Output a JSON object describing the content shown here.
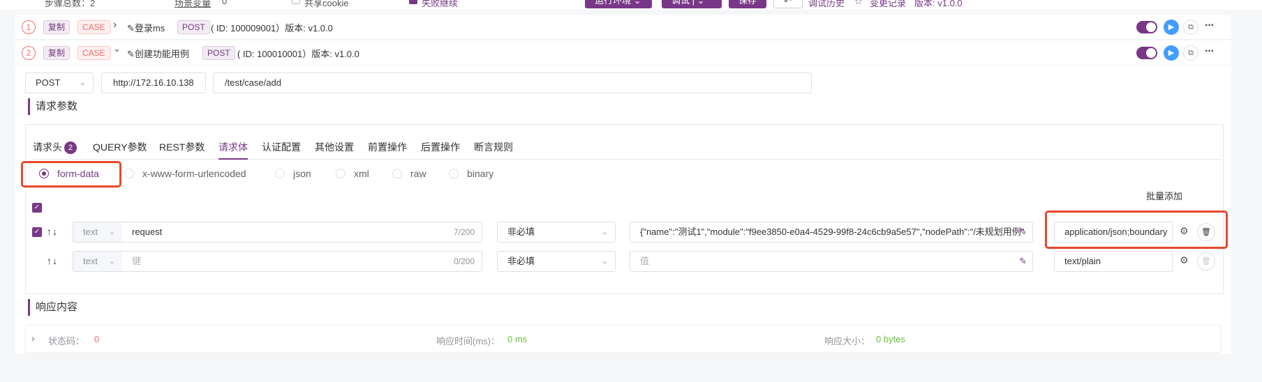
{
  "topbar": {
    "scenario_vars_count_label": "步骤总数：2",
    "scenario_vars_label": "场景变量",
    "scenario_vars_count": "0",
    "share_cookie_label": "共享cookie",
    "fail_stop_label": "失败继续",
    "run_env_button": "运行环境",
    "debug_button": "调试",
    "save_button": "保存",
    "debug_history_link": "调试历史",
    "change_record_link": "变更记录",
    "version_label": "版本: v1.0.0"
  },
  "steps": [
    {
      "index": "1",
      "copy_tag": "复制",
      "case_tag": "CASE",
      "chevron": "›",
      "name": "登录ms",
      "method": "POST",
      "meta": "( ID: 100009001）版本: v1.0.0"
    },
    {
      "index": "2",
      "copy_tag": "复制",
      "case_tag": "CASE",
      "chevron": "⌄",
      "name": "创建功能用例",
      "method": "POST",
      "meta": "( ID: 100010001）版本: v1.0.0"
    }
  ],
  "request": {
    "method": "POST",
    "host": "http://172.16.10.138",
    "path": "/test/case/add"
  },
  "params_section_title": "请求参数",
  "tabs": [
    {
      "label": "请求头",
      "badge": "2"
    },
    {
      "label": "QUERY参数"
    },
    {
      "label": "REST参数"
    },
    {
      "label": "请求体",
      "active": true
    },
    {
      "label": "认证配置"
    },
    {
      "label": "其他设置"
    },
    {
      "label": "前置操作"
    },
    {
      "label": "后置操作"
    },
    {
      "label": "断言规则"
    }
  ],
  "body_types": [
    "form-data",
    "x-www-form-urlencoded",
    "json",
    "xml",
    "raw",
    "binary"
  ],
  "body_type_selected": "form-data",
  "batch_add_label": "批量添加",
  "form_rows": [
    {
      "checked": true,
      "arrows": "↑↓",
      "type": "text",
      "key": "request",
      "key_count": "7/200",
      "required": "非必填",
      "value": "{\"name\":\"测试1\",\"module\":\"f9ee3850-e0a4-4529-99f8-24c6cb9a5e57\",\"nodePath\":\"/未规划用例\"",
      "content_type": "application/json;boundary"
    },
    {
      "checked": false,
      "arrows": "↑↓",
      "type": "text",
      "key_placeholder": "键",
      "key_count": "0/200",
      "required": "非必填",
      "value_placeholder": "值",
      "content_type": "text/plain"
    }
  ],
  "response_section_title": "响应内容",
  "response": {
    "status_label": "状态码：",
    "status_value": "0",
    "time_label": "响应时间(ms)：",
    "time_value": "0 ms",
    "size_label": "响应大小：",
    "size_value": "0 bytes"
  },
  "colors": {
    "accent": "#783887",
    "highlight": "#e8472b",
    "success": "#67c23a",
    "danger": "#f56c6c"
  }
}
